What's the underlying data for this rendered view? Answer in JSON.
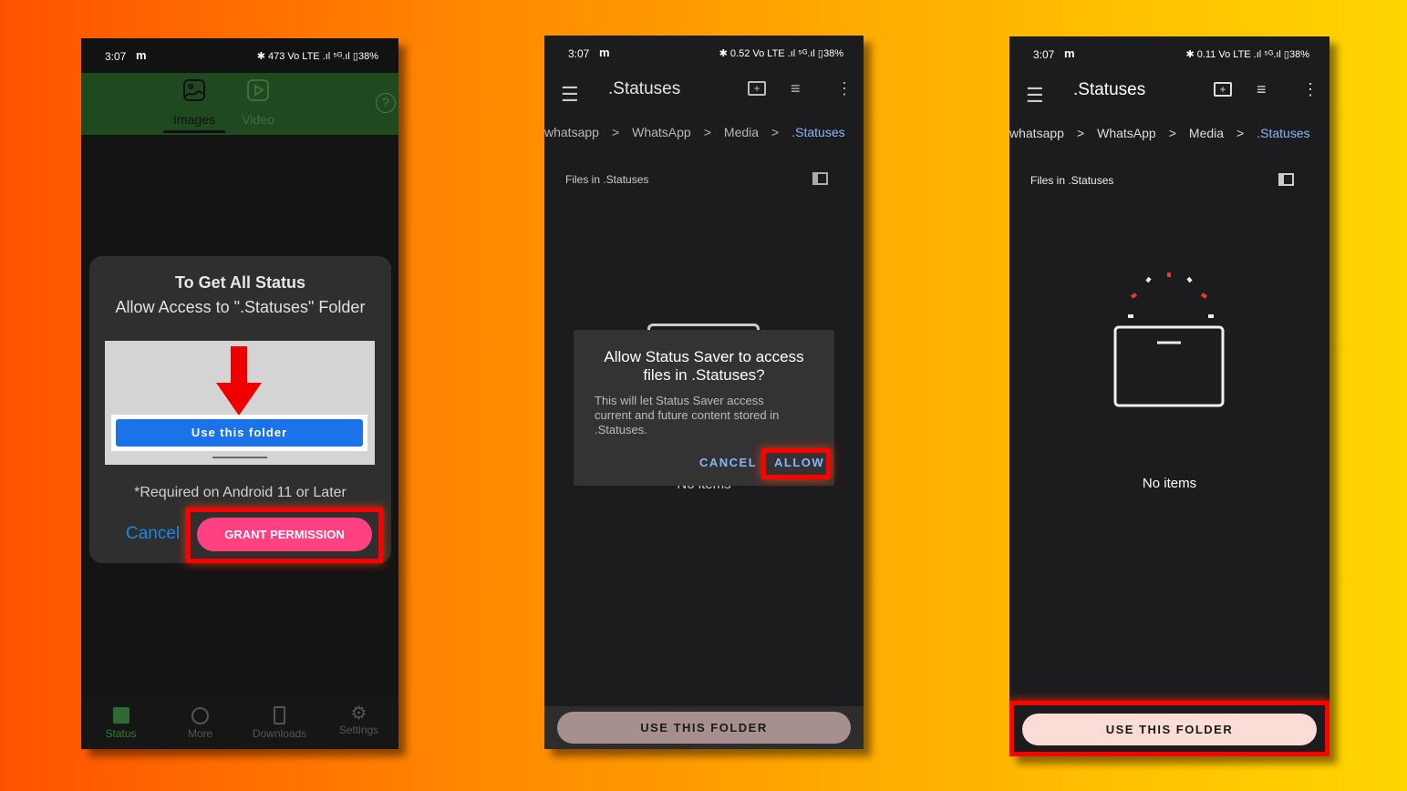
{
  "status_bar": [
    {
      "time": "3:07",
      "carrier": "m",
      "right": "✱ 473 Vo LTE .ıl ⁵ᴳ.ıl ▯38%"
    },
    {
      "time": "3:07",
      "carrier": "m",
      "right": "✱ 0.52 Vo LTE .ıl ⁵ᴳ.ıl ▯38%"
    },
    {
      "time": "3:07",
      "carrier": "m",
      "right": "✱ 0.11 Vo LTE .ıl ⁵ᴳ.ıl ▯38%"
    }
  ],
  "phone1": {
    "tabs": [
      {
        "label": "Images",
        "icon": "image-icon",
        "active": true
      },
      {
        "label": "Video",
        "icon": "play-square-icon",
        "active": false
      }
    ],
    "help_icon": "help-icon",
    "dialog": {
      "title": "To Get All Status",
      "subtitle": "Allow Access to \".Statuses\" Folder",
      "illustration_button": "Use this folder",
      "note": "*Required on Android 11 or Later",
      "cancel": "Cancel",
      "grant": "GRANT PERMISSION"
    },
    "nav": [
      {
        "label": "Status",
        "active": true
      },
      {
        "label": "More"
      },
      {
        "label": "Downloads"
      },
      {
        "label": "Settings"
      }
    ]
  },
  "picker": {
    "title": ".Statuses",
    "breadcrumbs": [
      "whatsapp",
      "WhatsApp",
      "Media",
      ".Statuses"
    ],
    "files_label": "Files in .Statuses",
    "empty": "No items",
    "use_folder": "USE THIS FOLDER"
  },
  "phone2": {
    "dialog": {
      "title": "Allow Status Saver to access files in .Statuses?",
      "body": "This will let Status Saver access current and future content stored in .Statuses.",
      "cancel": "CANCEL",
      "allow": "ALLOW"
    }
  },
  "colors": {
    "accent_pink": "#ff4081",
    "highlight": "#ff0000",
    "link_blue": "#8ab4f8",
    "green_header": "#1f4a1f"
  }
}
